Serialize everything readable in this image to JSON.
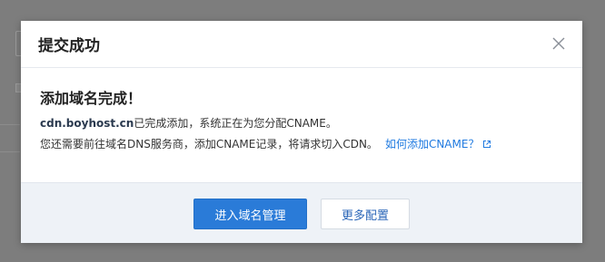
{
  "dialog": {
    "title": "提交成功",
    "close_icon": "close-icon"
  },
  "body": {
    "heading": "添加域名完成！",
    "domain": "cdn.boyhost.cn",
    "line1_rest": "已完成添加，系统正在为您分配CNAME。",
    "line2_text": "您还需要前往域名DNS服务商，添加CNAME记录，将请求切入CDN。",
    "help_link": "如何添加CNAME？",
    "help_link_icon": "external-link-icon"
  },
  "footer": {
    "primary_button": "进入域名管理",
    "secondary_button": "更多配置"
  },
  "colors": {
    "accent": "#2a7bd8",
    "link": "#1f7ae0",
    "footer_bg": "#eef2f7",
    "overlay": "#7d7d7d"
  }
}
